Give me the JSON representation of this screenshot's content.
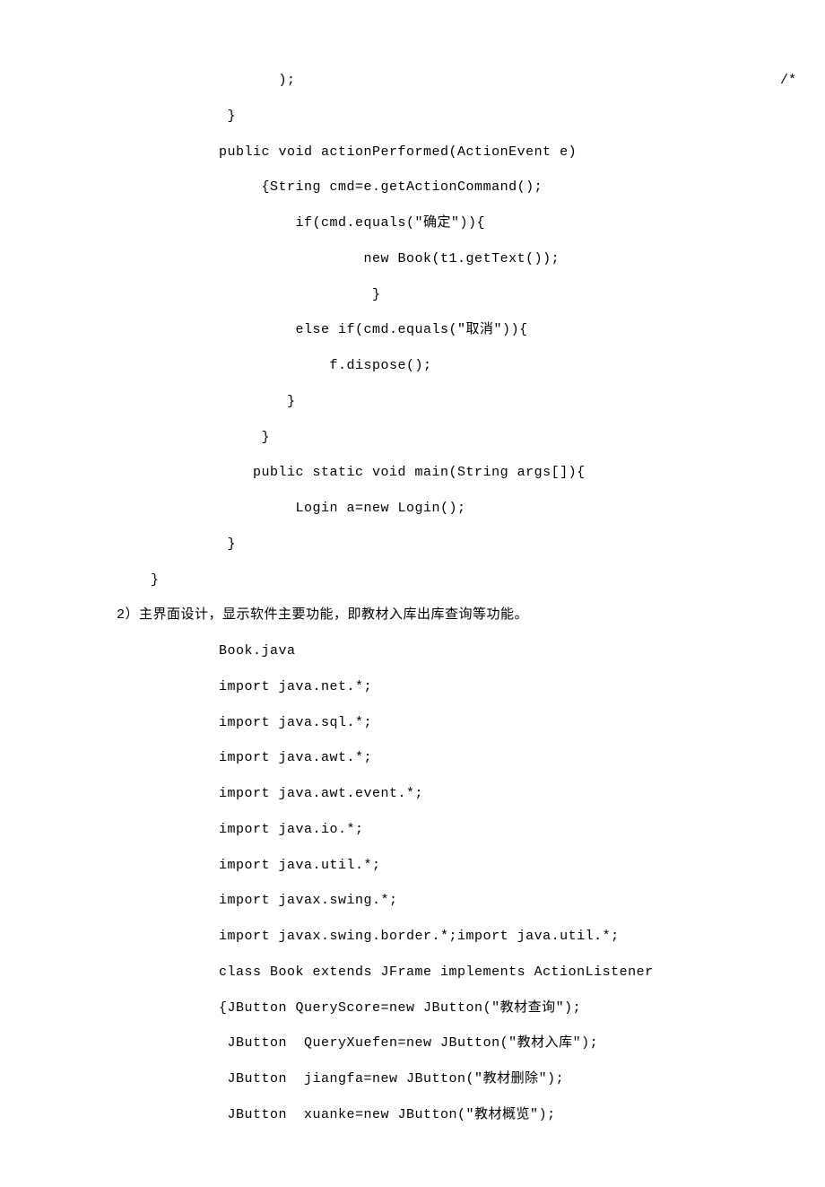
{
  "commentMarker": "/*",
  "lines": [
    {
      "type": "code",
      "indent": 4,
      "text": "   );"
    },
    {
      "type": "code",
      "indent": 3,
      "text": " }"
    },
    {
      "type": "code",
      "indent": 3,
      "text": "public void actionPerformed(ActionEvent e)"
    },
    {
      "type": "code",
      "indent": 4,
      "text": " {String cmd=e.getActionCommand();"
    },
    {
      "type": "code",
      "indent": 5,
      "text": " if(cmd.equals(\"确定\")){"
    },
    {
      "type": "code",
      "indent": 7,
      "text": " new Book(t1.getText());"
    },
    {
      "type": "code",
      "indent": 7,
      "text": "  }"
    },
    {
      "type": "code",
      "indent": 5,
      "text": " else if(cmd.equals(\"取消\")){"
    },
    {
      "type": "code",
      "indent": 6,
      "text": " f.dispose();"
    },
    {
      "type": "code",
      "indent": 5,
      "text": "}"
    },
    {
      "type": "code",
      "indent": 4,
      "text": " }"
    },
    {
      "type": "code",
      "indent": 4,
      "text": "public static void main(String args[]){"
    },
    {
      "type": "code",
      "indent": 5,
      "text": " Login a=new Login();"
    },
    {
      "type": "code",
      "indent": 3,
      "text": " }"
    },
    {
      "type": "code",
      "indent": 1,
      "text": "}"
    },
    {
      "type": "section",
      "indent": 1,
      "text": "2）主界面设计，显示软件主要功能，即教材入库出库查询等功能。"
    },
    {
      "type": "code",
      "indent": 3,
      "text": "Book.java"
    },
    {
      "type": "code",
      "indent": 3,
      "text": "import java.net.*;"
    },
    {
      "type": "code",
      "indent": 3,
      "text": "import java.sql.*;"
    },
    {
      "type": "code",
      "indent": 3,
      "text": "import java.awt.*;"
    },
    {
      "type": "code",
      "indent": 3,
      "text": "import java.awt.event.*;"
    },
    {
      "type": "code",
      "indent": 3,
      "text": "import java.io.*;"
    },
    {
      "type": "code",
      "indent": 3,
      "text": "import java.util.*;"
    },
    {
      "type": "code",
      "indent": 3,
      "text": "import javax.swing.*;"
    },
    {
      "type": "code",
      "indent": 3,
      "text": "import javax.swing.border.*;import java.util.*;"
    },
    {
      "type": "code",
      "indent": 3,
      "text": "class Book extends JFrame implements ActionListener"
    },
    {
      "type": "code",
      "indent": 3,
      "text": "{JButton QueryScore=new JButton(\"教材查询\");"
    },
    {
      "type": "code",
      "indent": 3,
      "text": " JButton  QueryXuefen=new JButton(\"教材入库\");"
    },
    {
      "type": "code",
      "indent": 3,
      "text": " JButton  jiangfa=new JButton(\"教材删除\");"
    },
    {
      "type": "code",
      "indent": 3,
      "text": " JButton  xuanke=new JButton(\"教材概览\");"
    }
  ]
}
